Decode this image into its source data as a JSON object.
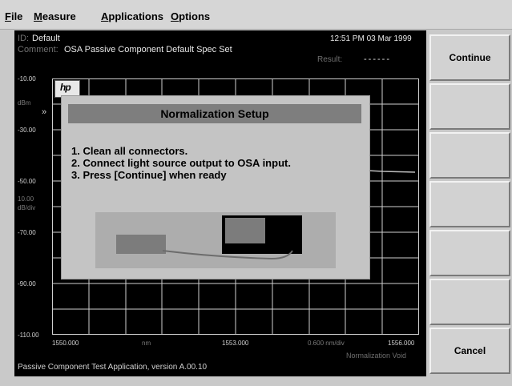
{
  "menu": [
    {
      "label": "File",
      "accel": "F",
      "rest": "ile"
    },
    {
      "label": "Measure",
      "accel": "M",
      "rest": "easure"
    },
    {
      "label": "Applications",
      "accel": "A",
      "rest": "pplications"
    },
    {
      "label": "Options",
      "accel": "O",
      "rest": "ptions"
    }
  ],
  "header": {
    "id_label": "ID:",
    "id_value": "Default",
    "datetime": "12:51 PM 03 Mar 1999",
    "comment_label": "Comment:",
    "comment_value": "OSA Passive Component Default Spec Set",
    "result_label": "Result:",
    "result_value": "------"
  },
  "plot": {
    "y_ticks": [
      "-10.00",
      "-30.00",
      "-50.00",
      "-70.00",
      "-90.00",
      "-110.00"
    ],
    "y_unit": "dBm",
    "y_scale": "10.00",
    "y_scale_unit": "dB/div",
    "x_start": "1550.000",
    "x_unit": "nm",
    "x_center": "1553.000",
    "x_span": "0.600 nm/div",
    "x_stop": "1556.000",
    "status": "Normalization Void"
  },
  "dialog": {
    "title": "Normalization Setup",
    "steps": [
      "1. Clean all connectors.",
      "2. Connect light source output to OSA input.",
      "3. Press [Continue] when ready"
    ]
  },
  "footer": "Passive Component Test Application, version A.00.10",
  "softkeys": [
    "Continue",
    "",
    "",
    "",
    "",
    "",
    "Cancel"
  ],
  "colors": {
    "screen_bg": "#000000",
    "dialog_bg": "#c4c4c4",
    "dialog_title_bg": "#7e7e7e",
    "softkey_bg": "#d2d2d2"
  }
}
